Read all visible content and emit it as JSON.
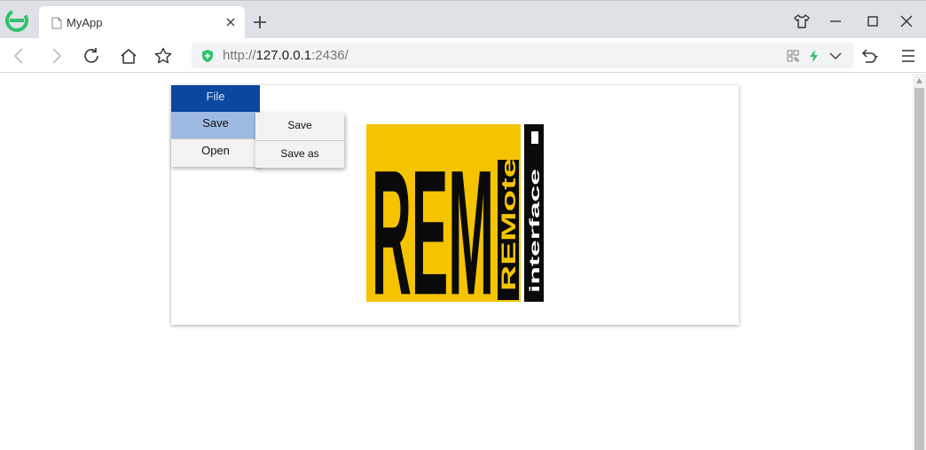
{
  "browser": {
    "tab_title": "MyApp",
    "url_prefix": "http://",
    "url_host": "127.0.0.1",
    "url_rest": ":2436/",
    "accent_color": "#2fc26b"
  },
  "icons": {
    "browser_logo": "edge-e-icon",
    "tab": "page-icon",
    "close": "close-icon",
    "new_tab": "plus-icon",
    "skin": "tshirt-icon",
    "minimize": "minimize-icon",
    "maximize": "maximize-icon",
    "window_close": "close-icon",
    "back": "back-icon",
    "forward": "forward-icon",
    "reload": "reload-icon",
    "home": "home-icon",
    "bookmark": "star-icon",
    "secure": "shield-icon",
    "qr": "qr-code-icon",
    "speed": "lightning-icon",
    "dropdown": "chevron-down-icon",
    "undo": "undo-icon",
    "menu": "hamburger-menu-icon"
  },
  "menu": {
    "file_label": "File",
    "file_color": "#0a47a1",
    "items": [
      {
        "label": "Save",
        "highlight": "#9ebae2"
      },
      {
        "label": "Open"
      }
    ],
    "submenu": [
      {
        "label": "Save"
      },
      {
        "label": "Save as"
      }
    ]
  },
  "logo": {
    "main_text": "REM",
    "side_text": "REMote",
    "bar_text": "interface",
    "colors": {
      "gold": "#f5c400",
      "black": "#0a0a0a",
      "white": "#ffffff"
    }
  }
}
